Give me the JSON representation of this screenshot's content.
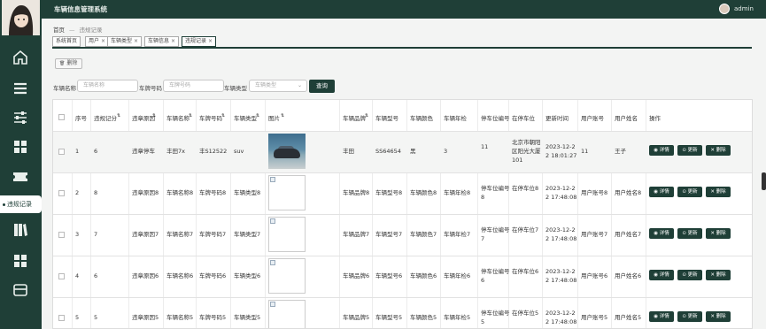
{
  "app": {
    "title": "车辆信息管理系统",
    "user": "admin"
  },
  "sidebar": {
    "active_label": "违规记录"
  },
  "breadcrumb": {
    "home": "首页",
    "separator": "—",
    "current": "违规记录"
  },
  "tabs": [
    {
      "label": "系统首页",
      "closable": false
    },
    {
      "label": "用户",
      "closable": true
    },
    {
      "label": "车辆类型",
      "closable": true
    },
    {
      "label": "车辆信息",
      "closable": true
    },
    {
      "label": "违规记录",
      "closable": true
    }
  ],
  "toolbar": {
    "delete_label": "删除"
  },
  "filters": {
    "name_label": "车辆名称",
    "name_placeholder": "车辆名称",
    "plate_label": "车牌号码",
    "plate_placeholder": "车牌号码",
    "type_label": "车辆类型",
    "type_placeholder": "车辆类型",
    "search_label": "查询"
  },
  "table": {
    "headers": [
      "序号",
      "违规记分",
      "违章原因",
      "车辆名称",
      "车牌号码",
      "车辆类型",
      "图片",
      "车辆品牌",
      "车辆型号",
      "车辆颜色",
      "车辆年检",
      "停车位编号",
      "在停车位",
      "更新时间",
      "用户账号",
      "用户姓名",
      "操作"
    ],
    "actions": [
      "详情",
      "更新",
      "删除"
    ],
    "rows": [
      {
        "idx": "1",
        "score": "6",
        "reason": "违章停车",
        "name": "丰田7x",
        "plate": "丰S12522",
        "type": "suv",
        "image": "car",
        "brand": "丰田",
        "model": "SS64654",
        "color": "黑",
        "inspect": "3",
        "slot": "11",
        "location": "北京市朝阳区阳光大厦101",
        "time": "2023-12-22 18:01:27",
        "account": "11",
        "username": "王子"
      },
      {
        "idx": "2",
        "score": "8",
        "reason": "违章原因8",
        "name": "车辆名称8",
        "plate": "车牌号码8",
        "type": "车辆类型8",
        "image": "broken",
        "brand": "车辆品牌8",
        "model": "车辆型号8",
        "color": "车辆颜色8",
        "inspect": "车辆年检8",
        "slot": "停车位编号8",
        "location": "在停车位8",
        "time": "2023-12-22 17:48:08",
        "account": "用户账号8",
        "username": "用户姓名8"
      },
      {
        "idx": "3",
        "score": "7",
        "reason": "违章原因7",
        "name": "车辆名称7",
        "plate": "车牌号码7",
        "type": "车辆类型7",
        "image": "broken",
        "brand": "车辆品牌7",
        "model": "车辆型号7",
        "color": "车辆颜色7",
        "inspect": "车辆年检7",
        "slot": "停车位编号7",
        "location": "在停车位7",
        "time": "2023-12-22 17:48:08",
        "account": "用户账号7",
        "username": "用户姓名7"
      },
      {
        "idx": "4",
        "score": "6",
        "reason": "违章原因6",
        "name": "车辆名称6",
        "plate": "车牌号码6",
        "type": "车辆类型6",
        "image": "broken",
        "brand": "车辆品牌6",
        "model": "车辆型号6",
        "color": "车辆颜色6",
        "inspect": "车辆年检6",
        "slot": "停车位编号6",
        "location": "在停车位6",
        "time": "2023-12-22 17:48:08",
        "account": "用户账号6",
        "username": "用户姓名6"
      },
      {
        "idx": "5",
        "score": "5",
        "reason": "违章原因5",
        "name": "车辆名称5",
        "plate": "车牌号码5",
        "type": "车辆类型5",
        "image": "broken",
        "brand": "车辆品牌5",
        "model": "车辆型号5",
        "color": "车辆颜色5",
        "inspect": "车辆年检5",
        "slot": "停车位编号5",
        "location": "在停车位5",
        "time": "2023-12-22 17:48:08",
        "account": "用户账号5",
        "username": "用户姓名5"
      }
    ]
  },
  "colors": {
    "primary": "#1f3f37",
    "background": "#f3f4f3"
  }
}
